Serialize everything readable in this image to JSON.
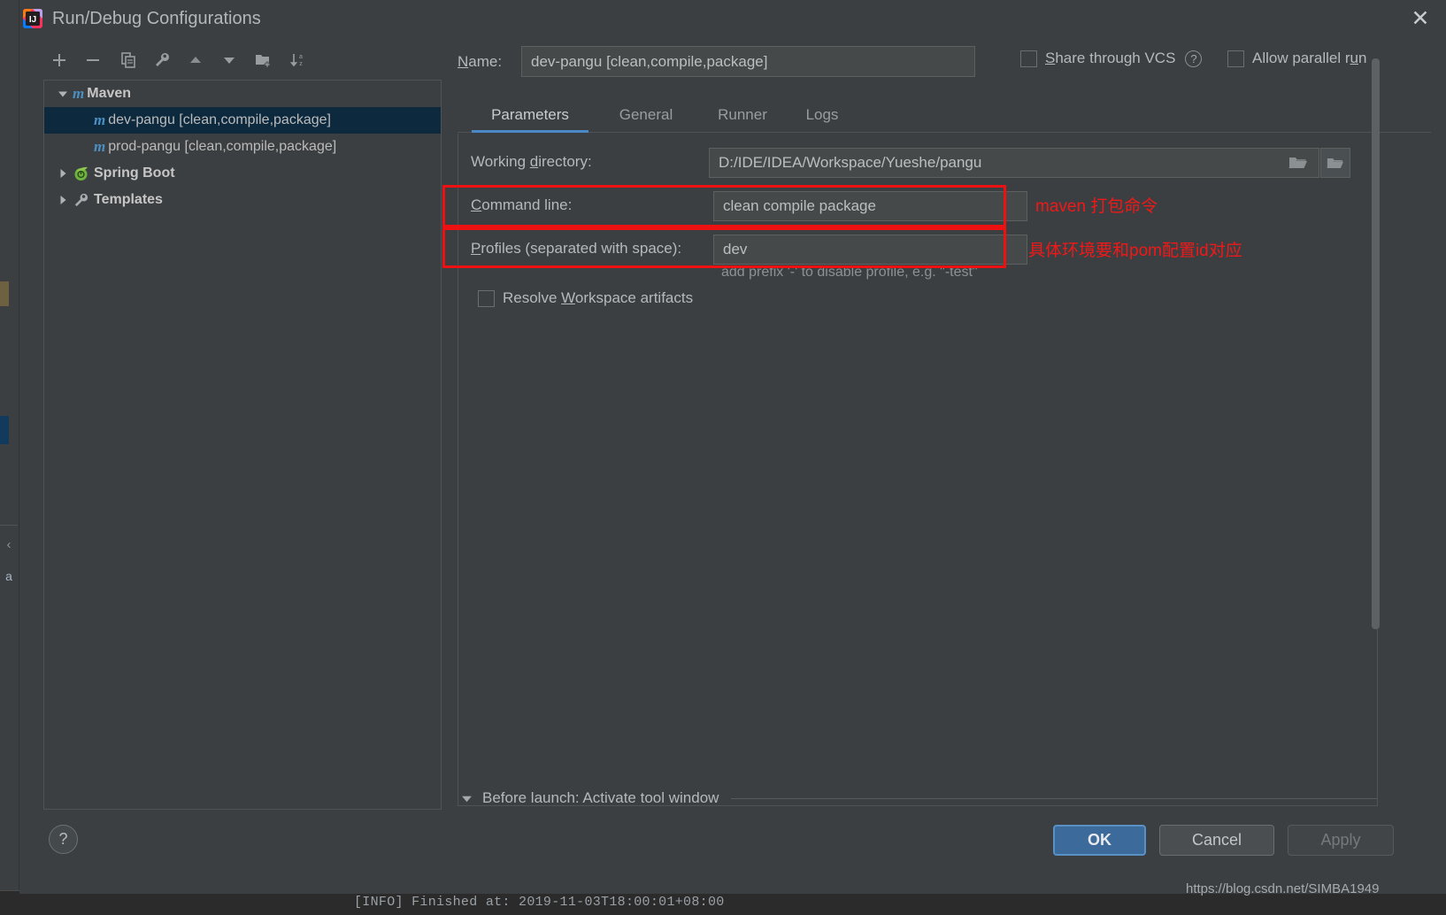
{
  "window": {
    "title": "Run/Debug Configurations",
    "app_icon": "intellij-idea-icon",
    "close_label": "✕"
  },
  "toolbar": {
    "buttons": [
      {
        "name": "add-configuration-button",
        "icon": "plus-icon",
        "tooltip": "Add New Configuration"
      },
      {
        "name": "remove-configuration-button",
        "icon": "minus-icon",
        "tooltip": "Remove Configuration"
      },
      {
        "name": "copy-configuration-button",
        "icon": "copy-icon",
        "tooltip": "Copy Configuration"
      },
      {
        "name": "edit-templates-button",
        "icon": "wrench-icon",
        "tooltip": "Edit Templates"
      },
      {
        "name": "move-up-button",
        "icon": "triangle-up-icon",
        "tooltip": "Move Up"
      },
      {
        "name": "move-down-button",
        "icon": "triangle-down-icon",
        "tooltip": "Move Down"
      },
      {
        "name": "new-folder-button",
        "icon": "folder-add-icon",
        "tooltip": "Create New Folder"
      },
      {
        "name": "sort-button",
        "icon": "sort-az-icon",
        "tooltip": "Sort Configurations"
      }
    ]
  },
  "tree": {
    "nodes": [
      {
        "label": "Maven",
        "icon": "maven-m-icon",
        "expanded": true,
        "level": 0,
        "bold": true,
        "selected": false,
        "twisty": "down"
      },
      {
        "label": "dev-pangu [clean,compile,package]",
        "icon": "maven-m-icon",
        "level": 1,
        "bold": false,
        "selected": true,
        "twisty": "none"
      },
      {
        "label": "prod-pangu [clean,compile,package]",
        "icon": "maven-m-icon",
        "level": 1,
        "bold": false,
        "selected": false,
        "twisty": "none"
      },
      {
        "label": "Spring Boot",
        "icon": "spring-boot-leaf-icon",
        "expanded": false,
        "level": 0,
        "bold": true,
        "selected": false,
        "twisty": "right"
      },
      {
        "label": "Templates",
        "icon": "wrench-icon",
        "expanded": false,
        "level": 0,
        "bold": true,
        "selected": false,
        "twisty": "right"
      }
    ]
  },
  "header": {
    "name_label": "Name:",
    "name_mnemonic": "N",
    "name_value": "dev-pangu [clean,compile,package]",
    "share_vcs_label": "Share through VCS",
    "share_vcs_mnemonic": "S",
    "share_vcs_checked": false,
    "help_icon_label": "?",
    "allow_parallel_label": "Allow parallel run",
    "allow_parallel_mnemonic": "u",
    "allow_parallel_checked": false
  },
  "tabs": {
    "items": [
      {
        "label": "Parameters",
        "active": true
      },
      {
        "label": "General",
        "active": false
      },
      {
        "label": "Runner",
        "active": false
      },
      {
        "label": "Logs",
        "active": false
      }
    ]
  },
  "parameters": {
    "working_directory_label": "Working directory:",
    "working_directory_mnemonic": "d",
    "working_directory_value": "D:/IDE/IDEA/Workspace/Yueshe/pangu",
    "command_line_label": "Command line:",
    "command_line_mnemonic": "C",
    "command_line_value": "clean compile package",
    "profiles_label": "Profiles (separated with space):",
    "profiles_mnemonic": "P",
    "profiles_value": "dev",
    "profiles_hint": "add prefix '-' to disable profile, e.g. \"-test\"",
    "resolve_artifacts_label": "Resolve Workspace artifacts",
    "resolve_artifacts_mnemonic": "W",
    "resolve_artifacts_checked": false,
    "browse_icon": "folder-open-icon",
    "macro_icon": "folder-open-icon"
  },
  "annotations": {
    "command_line_note": "maven 打包命令",
    "profiles_note": "具体环境要和pom配置id对应",
    "box_color": "#ee1111"
  },
  "before_launch": {
    "text": "Before launch: Activate tool window",
    "expanded": true,
    "twisty_icon": "triangle-down-icon"
  },
  "footer": {
    "help_label": "?",
    "ok_label": "OK",
    "cancel_label": "Cancel",
    "apply_label": "Apply",
    "apply_enabled": false,
    "ok_accent_color": "#3c6a9a"
  },
  "background": {
    "watermark": "https://blog.csdn.net/SIMBA1949",
    "console_line": "[INFO] Finished at: 2019-11-03T18:00:01+08:00",
    "side_letter": "a",
    "side_chevron": "‹"
  }
}
